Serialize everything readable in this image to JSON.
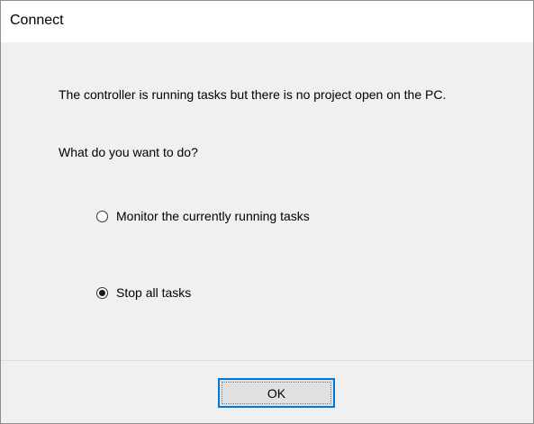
{
  "dialog": {
    "title": "Connect",
    "message": "The controller is running tasks but there is no project open on the PC.",
    "question": "What do you want to do?",
    "options": [
      {
        "label": "Monitor the currently running tasks",
        "selected": false
      },
      {
        "label": "Stop all tasks",
        "selected": true
      }
    ],
    "ok_label": "OK"
  },
  "colors": {
    "dialog_background": "#f0f0f0",
    "title_background": "#ffffff",
    "button_focus_border": "#0078d7"
  }
}
